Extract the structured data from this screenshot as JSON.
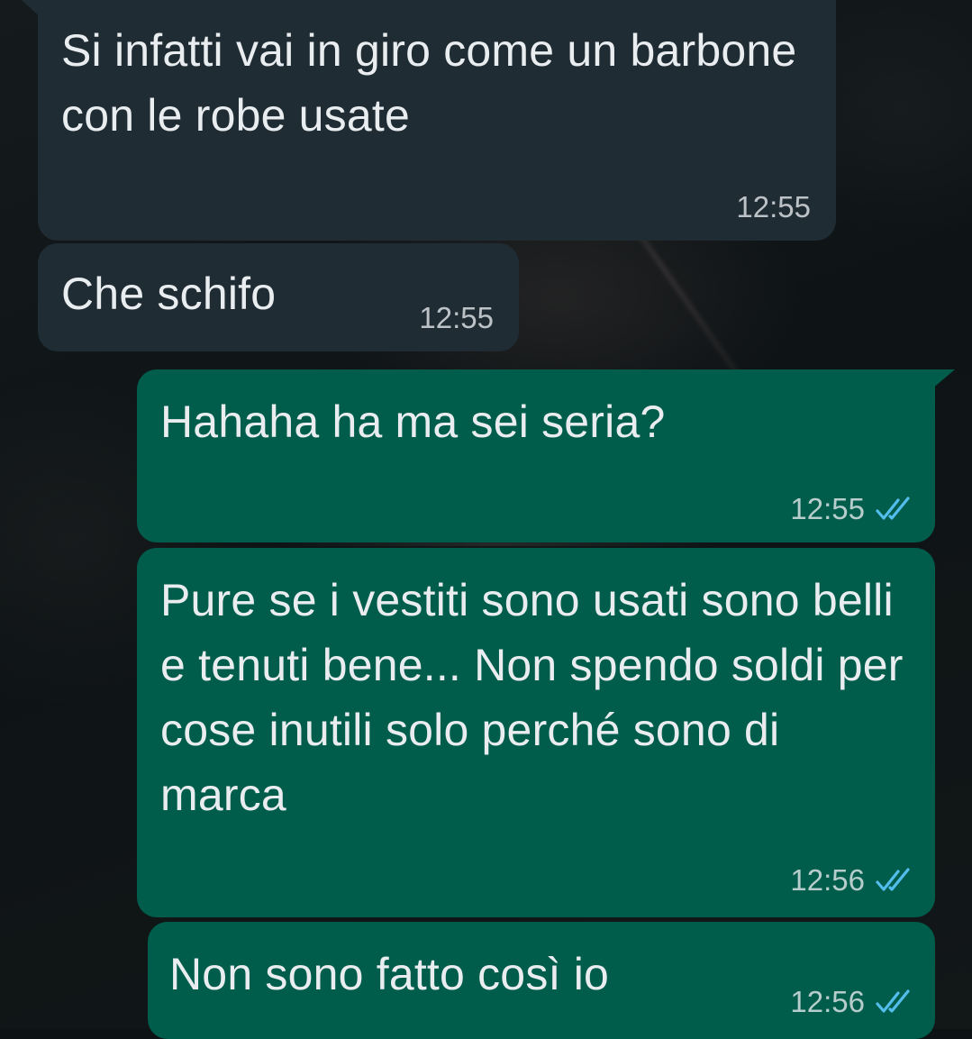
{
  "chat": {
    "messages": [
      {
        "direction": "incoming",
        "text": "Si infatti vai in giro come un barbone con le robe usate",
        "time": "12:55"
      },
      {
        "direction": "incoming",
        "text": "Che schifo",
        "time": "12:55"
      },
      {
        "direction": "outgoing",
        "text": "Hahaha ha ma sei seria?",
        "time": "12:55",
        "status_icon": "double-check-read-icon"
      },
      {
        "direction": "outgoing",
        "text": "Pure se i vestiti sono usati sono belli e tenuti bene... Non spendo soldi per cose inutili solo perché sono di marca",
        "time": "12:56",
        "status_icon": "double-check-read-icon"
      },
      {
        "direction": "outgoing",
        "text": "Non sono fatto così io",
        "time": "12:56",
        "status_icon": "double-check-read-icon"
      }
    ]
  },
  "colors": {
    "incoming_bubble": "#1f2c34",
    "outgoing_bubble": "#005c4b",
    "text": "#e9edef",
    "read_ticks": "#53bdeb"
  }
}
